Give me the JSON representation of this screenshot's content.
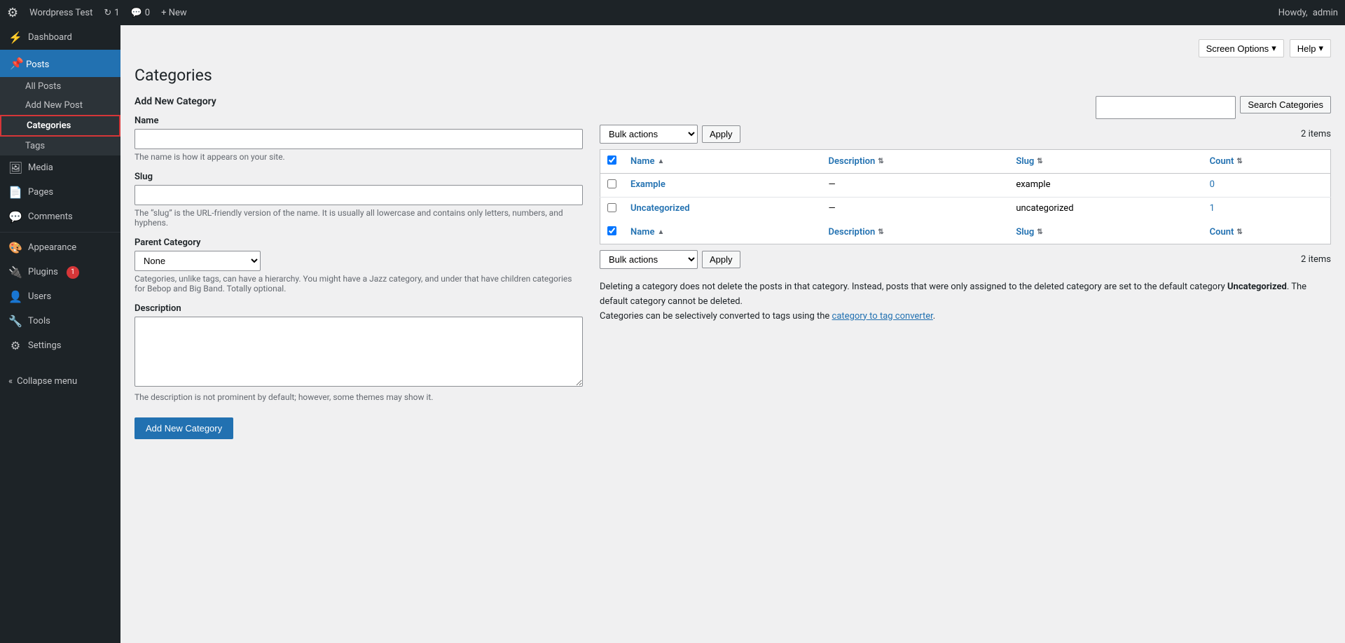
{
  "adminbar": {
    "logo": "W",
    "site_name": "Wordpress Test",
    "updates": "1",
    "comments": "0",
    "new_label": "+ New",
    "howdy": "Howdy,",
    "username": "admin"
  },
  "screen_options": {
    "screen_options_label": "Screen Options",
    "help_label": "Help"
  },
  "page": {
    "title": "Categories"
  },
  "form": {
    "section_title": "Add New Category",
    "name_label": "Name",
    "name_placeholder": "",
    "name_hint": "The name is how it appears on your site.",
    "slug_label": "Slug",
    "slug_placeholder": "",
    "slug_hint": "The “slug” is the URL-friendly version of the name. It is usually all lowercase and contains only letters, numbers, and hyphens.",
    "parent_label": "Parent Category",
    "parent_options": [
      "None"
    ],
    "parent_hint": "Categories, unlike tags, can have a hierarchy. You might have a Jazz category, and under that have children categories for Bebop and Big Band. Totally optional.",
    "description_label": "Description",
    "description_placeholder": "",
    "description_hint": "The description is not prominent by default; however, some themes may show it.",
    "submit_label": "Add New Category"
  },
  "table": {
    "search_placeholder": "",
    "search_button": "Search Categories",
    "bulk_actions_label": "Bulk actions",
    "apply_label": "Apply",
    "items_count": "2 items",
    "columns": {
      "name": "Name",
      "description": "Description",
      "slug": "Slug",
      "count": "Count"
    },
    "rows": [
      {
        "checked": false,
        "name": "Example",
        "description": "—",
        "slug": "example",
        "count": "0",
        "count_link": true
      },
      {
        "checked": false,
        "name": "Uncategorized",
        "description": "—",
        "slug": "uncategorized",
        "count": "1",
        "count_link": true
      }
    ],
    "footer_note1": "Deleting a category does not delete the posts in that category. Instead, posts that were only assigned to the deleted category are set to the default category ",
    "footer_note1_bold": "Uncategorized",
    "footer_note1_end": ". The default category cannot be deleted.",
    "footer_note2_pre": "Categories can be selectively converted to tags using the ",
    "footer_note2_link": "category to tag converter",
    "footer_note2_end": "."
  },
  "sidebar": {
    "dashboard_label": "Dashboard",
    "posts_label": "Posts",
    "all_posts_label": "All Posts",
    "add_new_post_label": "Add New Post",
    "categories_label": "Categories",
    "tags_label": "Tags",
    "media_label": "Media",
    "pages_label": "Pages",
    "comments_label": "Comments",
    "appearance_label": "Appearance",
    "plugins_label": "Plugins",
    "plugins_badge": "1",
    "users_label": "Users",
    "tools_label": "Tools",
    "settings_label": "Settings",
    "collapse_label": "Collapse menu"
  }
}
